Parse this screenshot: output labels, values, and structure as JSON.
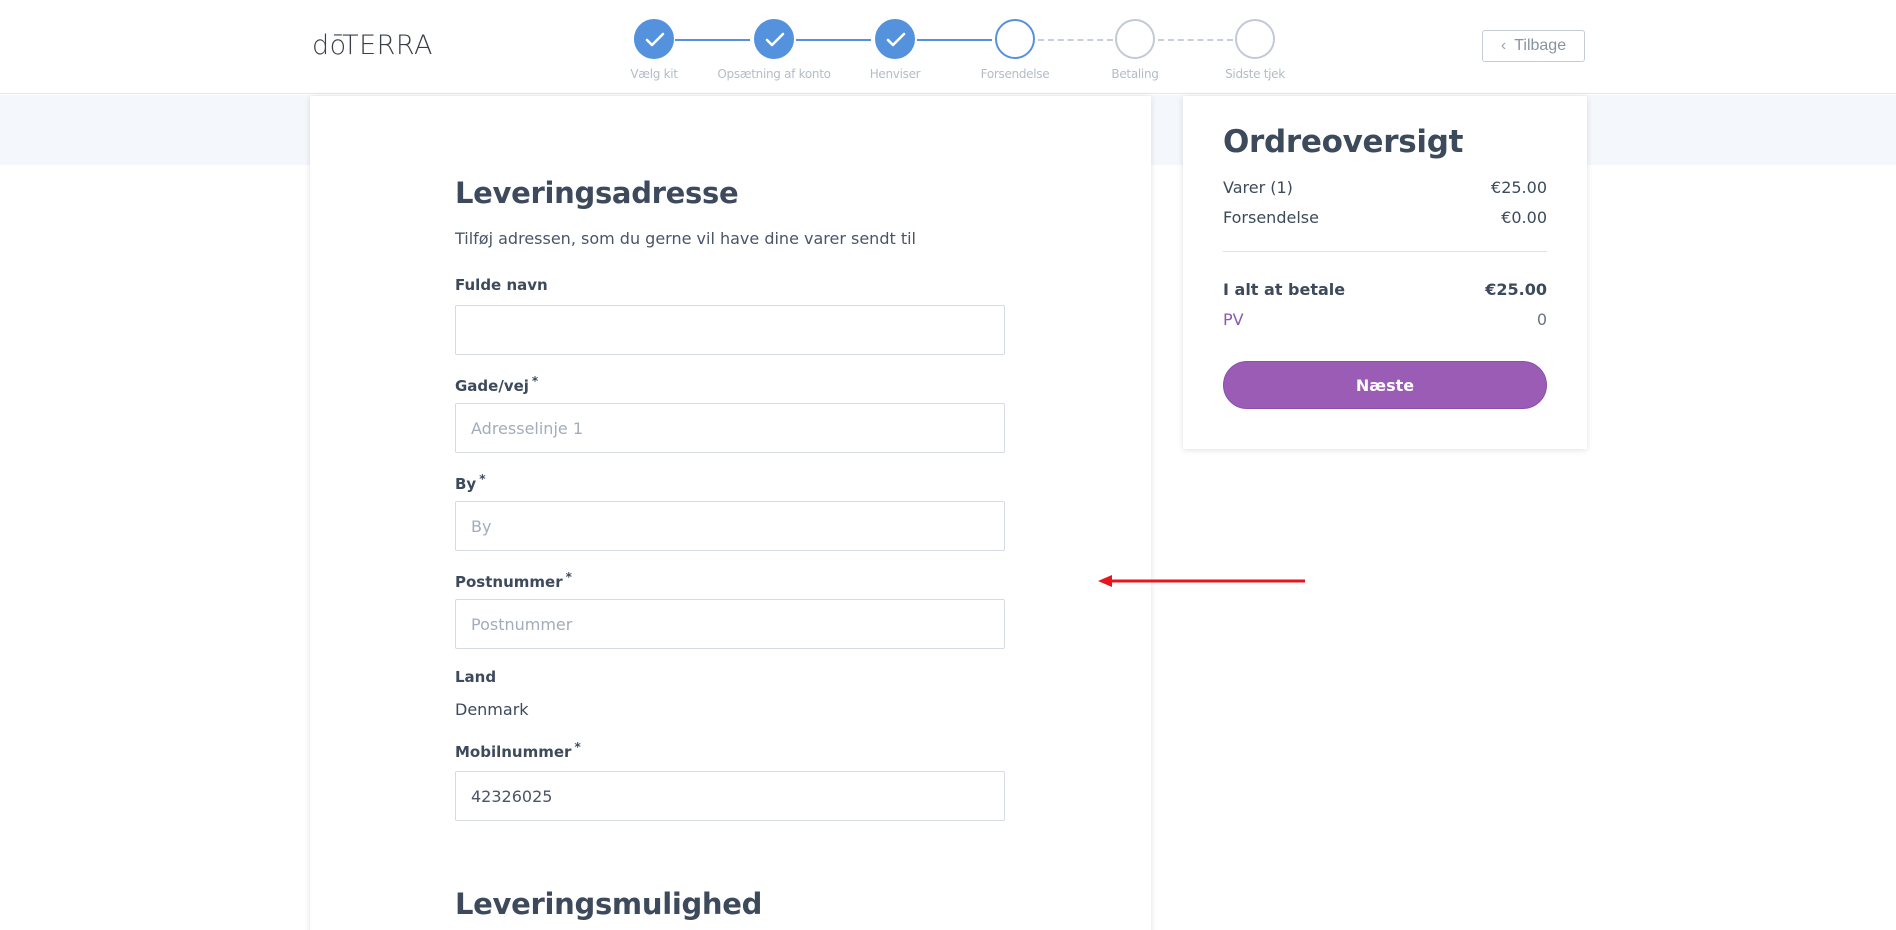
{
  "header": {
    "logo": "dōTERRA",
    "back_label": "Tilbage"
  },
  "stepper": {
    "steps": [
      {
        "label": "Vælg kit",
        "state": "done"
      },
      {
        "label": "Opsætning af konto",
        "state": "done"
      },
      {
        "label": "Henviser",
        "state": "done"
      },
      {
        "label": "Forsendelse",
        "state": "current"
      },
      {
        "label": "Betaling",
        "state": "todo"
      },
      {
        "label": "Sidste tjek",
        "state": "todo"
      }
    ]
  },
  "address": {
    "title": "Leveringsadresse",
    "subtitle": "Tilføj adressen, som du gerne vil have dine varer sendt til",
    "full_name": {
      "label": "Fulde navn",
      "value": "",
      "placeholder": ""
    },
    "street": {
      "label": "Gade/vej",
      "required": "*",
      "value": "",
      "placeholder": "Adresselinje 1"
    },
    "city": {
      "label": "By",
      "required": "*",
      "value": "",
      "placeholder": "By"
    },
    "postal": {
      "label": "Postnummer",
      "required": "*",
      "value": "",
      "placeholder": "Postnummer"
    },
    "country": {
      "label": "Land",
      "value": "Denmark"
    },
    "mobile": {
      "label": "Mobilnummer",
      "required": "*",
      "value": "42326025",
      "placeholder": ""
    }
  },
  "delivery": {
    "title": "Leveringsmulighed"
  },
  "summary": {
    "title": "Ordreoversigt",
    "items_label": "Varer (1)",
    "items_value": "€25.00",
    "shipping_label": "Forsendelse",
    "shipping_value": "€0.00",
    "total_label": "I alt at betale",
    "total_value": "€25.00",
    "pv_label": "PV",
    "pv_value": "0",
    "next_label": "Næste"
  },
  "colors": {
    "step_active": "#5592dd",
    "step_inactive": "#c3cad6",
    "next_button": "#9b5cb5",
    "pv_label": "#8c5aa9",
    "annotation_arrow": "#e8141e"
  }
}
